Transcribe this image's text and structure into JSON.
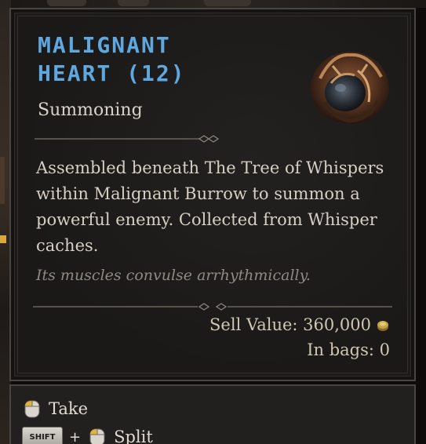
{
  "item": {
    "title_line1": "Malignant",
    "title_line2": "Heart (12)",
    "type": "Summoning",
    "description": "Assembled beneath The Tree of Whispers within Malignant Burrow to summon a powerful enemy. Collected from Whisper caches.",
    "flavor": "Its muscles convulse arrhythmically.",
    "sell_label": "Sell Value: 360,000",
    "bags_label": "In bags: 0",
    "image_icon": "malignant-heart-icon"
  },
  "actions": {
    "take_label": "Take",
    "shift_key_label": "SHIFT",
    "plus_label": "+",
    "split_label": "Split"
  },
  "colors": {
    "title": "#5ea8df",
    "text": "#d6cfc4",
    "flavor": "#8f8a83",
    "panel": "#1c1b1a",
    "gold": "#c9a24a"
  }
}
